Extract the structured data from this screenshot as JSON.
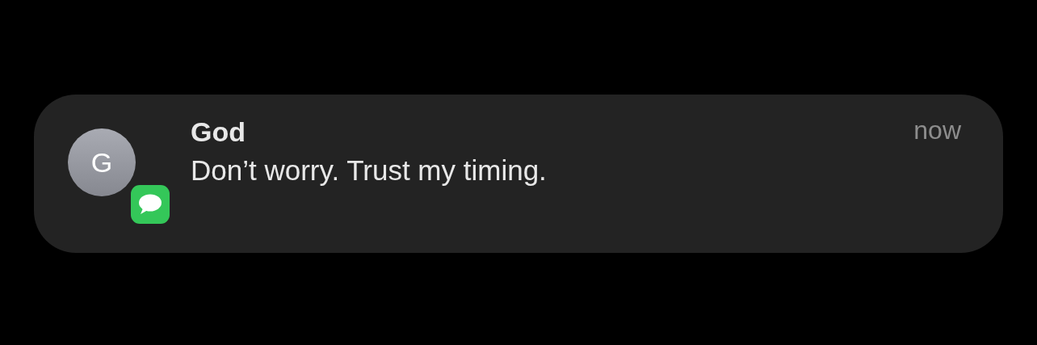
{
  "notification": {
    "avatar_initial": "G",
    "sender": "God",
    "message": "Don’t worry. Trust my timing.",
    "time": "now"
  }
}
